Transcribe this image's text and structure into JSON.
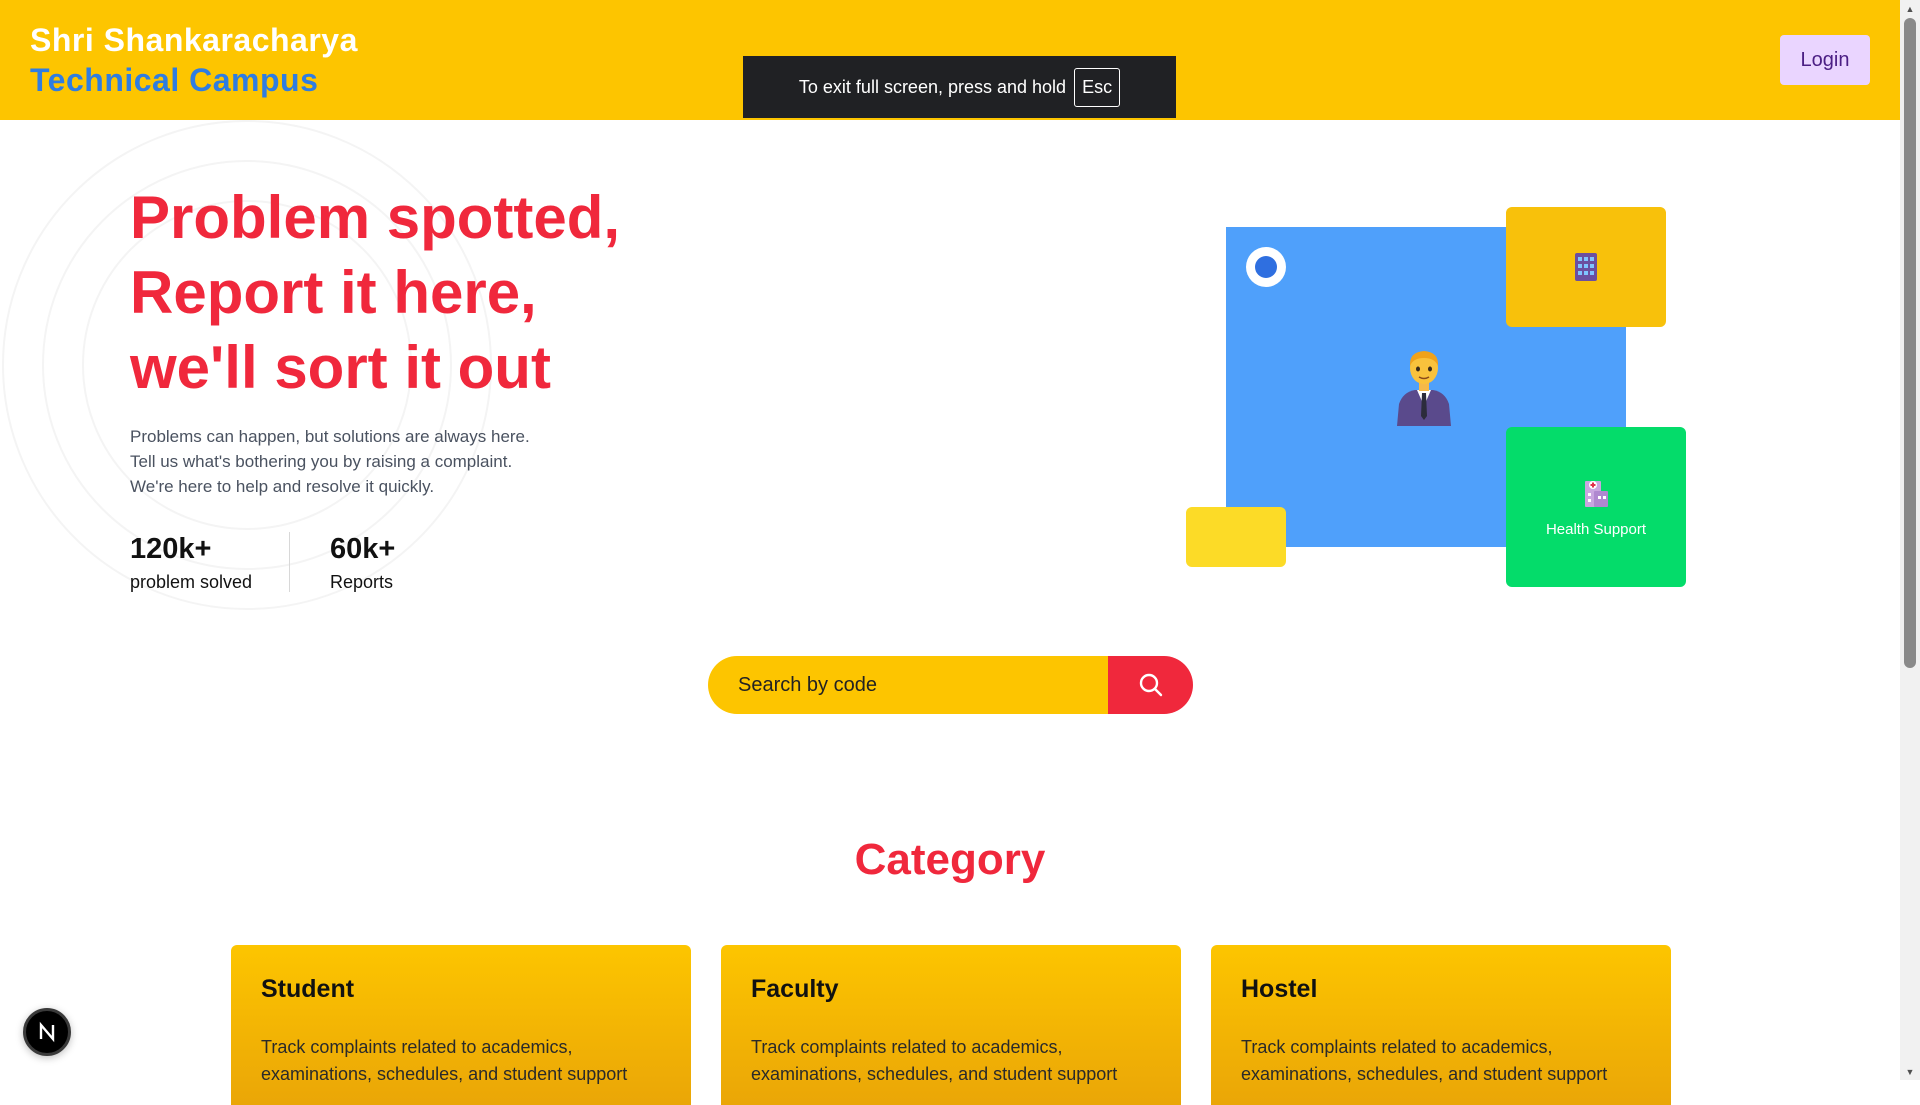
{
  "header": {
    "brand_line1": "Shri Shankaracharya",
    "brand_line2": "Technical Campus",
    "login_label": "Login"
  },
  "fullscreen_toast": {
    "message": "To exit full screen, press and hold",
    "key": "Esc"
  },
  "hero": {
    "title_lines": [
      "Problem spotted,",
      "Report it here,",
      "we'll sort it out"
    ],
    "description_lines": [
      "Problems can happen, but solutions are always here.",
      "Tell us what's bothering you by raising a complaint.",
      "We're here to help and resolve it quickly."
    ],
    "stats": [
      {
        "value": "120k+",
        "label": "problem solved"
      },
      {
        "value": "60k+",
        "label": "Reports"
      }
    ]
  },
  "illustration": {
    "green_card_label": "Health Support",
    "icons": [
      "building-icon",
      "person-icon",
      "hospital-icon"
    ]
  },
  "search": {
    "placeholder": "Search by code"
  },
  "category": {
    "title": "Category",
    "cards": [
      {
        "title": "Student",
        "description": "Track complaints related to academics, examinations, schedules, and student support"
      },
      {
        "title": "Faculty",
        "description": "Track complaints related to academics, examinations, schedules, and student support"
      },
      {
        "title": "Hostel",
        "description": "Track complaints related to academics, examinations, schedules, and student support"
      }
    ]
  },
  "colors": {
    "header_bg": "#fdc500",
    "accent_red": "#f0283c",
    "brand_blue": "#2f7de1",
    "illus_blue": "#4fa0fb",
    "illus_green": "#04dc6a"
  },
  "next_badge": {
    "letter": "N"
  }
}
